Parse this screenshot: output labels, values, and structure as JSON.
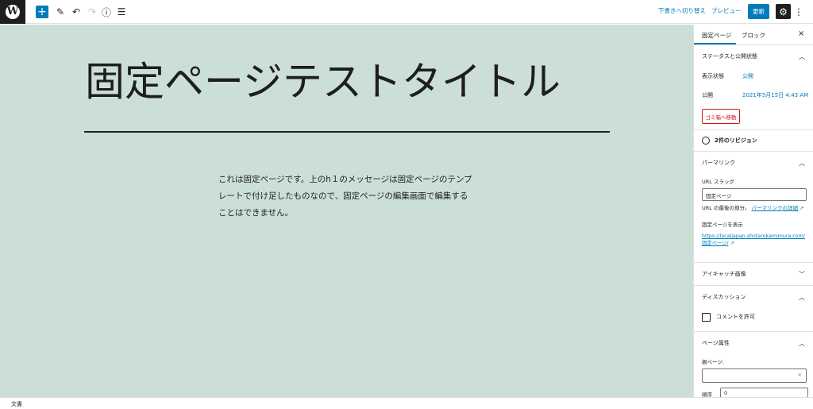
{
  "toolbar": {
    "add": "+",
    "edit": "✎",
    "undo": "↶",
    "redo": "↷",
    "info": "ⓘ",
    "outline": "☰",
    "switch_to_draft": "下書きへ切り替え",
    "preview": "プレビュー",
    "update": "更新",
    "settings": "⚙",
    "more": "⋮"
  },
  "content": {
    "title": "固定ページテストタイトル",
    "body_lines": [
      "これは固定ページです。上のh１のメッセージは固定ページのテンプ",
      "レートで付け足したものなので、固定ページの編集画面で編集する",
      "ことはできません。"
    ]
  },
  "sidebar": {
    "tabs": [
      "固定ページ",
      "ブロック"
    ],
    "close": "×",
    "status": {
      "heading": "ステータスと公開状態",
      "visibility_label": "表示状態",
      "visibility_value": "公開",
      "publish_label": "公開",
      "publish_value": "2021年5月15日 4:43 AM",
      "trash": "ゴミ箱へ移動"
    },
    "revisions": "2件のリビジョン",
    "permalink": {
      "heading": "パーマリンク",
      "slug_label": "URL スラッグ",
      "slug_value": "固定ページ",
      "note_prefix": "URL の最後の部分。",
      "note_link": "パーマリンクの詳細",
      "view_label": "固定ページを表示",
      "url_line1": "https://localjapan.shotarokamimura.com/",
      "url_line2": "固定ページ/"
    },
    "eyecatch": "アイキャッチ画像",
    "discussion": {
      "heading": "ディスカッション",
      "allow_comments": "コメントを許可"
    },
    "page_attributes": {
      "heading": "ページ属性",
      "parent_label": "親ページ:",
      "clear": "×",
      "order_label": "順序",
      "order_value": "0"
    }
  },
  "footer": {
    "breadcrumb": "文書"
  }
}
